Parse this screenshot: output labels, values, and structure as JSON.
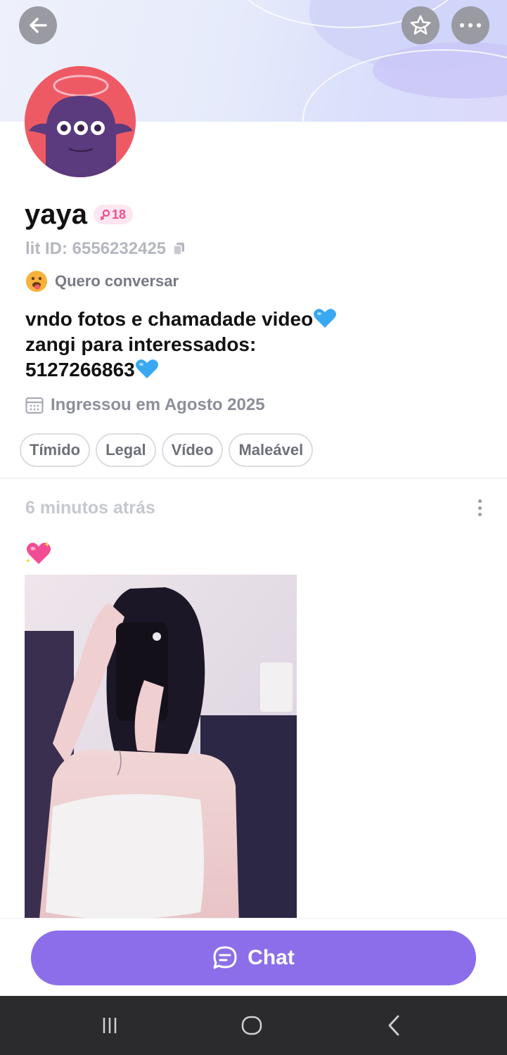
{
  "profile": {
    "name": "yaya",
    "age_badge": "18",
    "lit_id": "lit ID: 6556232425",
    "mood": "Quero conversar",
    "bio_lines": [
      "vndo fotos e chamadade video",
      "zangi para interessados:",
      "5127266863"
    ],
    "joined": "Ingressou em Agosto 2025",
    "tags": [
      "Tímido",
      "Legal",
      "Vídeo",
      "Maleável"
    ]
  },
  "post": {
    "time": "6 minutos atrás"
  },
  "actions": {
    "chat_label": "Chat"
  },
  "colors": {
    "accent": "#8c6eea",
    "badge_pink": "#ef4f8f",
    "avatar_bg": "#ee5a64",
    "avatar_monster": "#5b3a7e"
  },
  "icons": {
    "back": "arrow-left-icon",
    "star": "star-icon",
    "more": "more-horizontal-icon",
    "copy": "copy-icon",
    "calendar": "calendar-icon",
    "chat": "chat-bubble-icon"
  }
}
